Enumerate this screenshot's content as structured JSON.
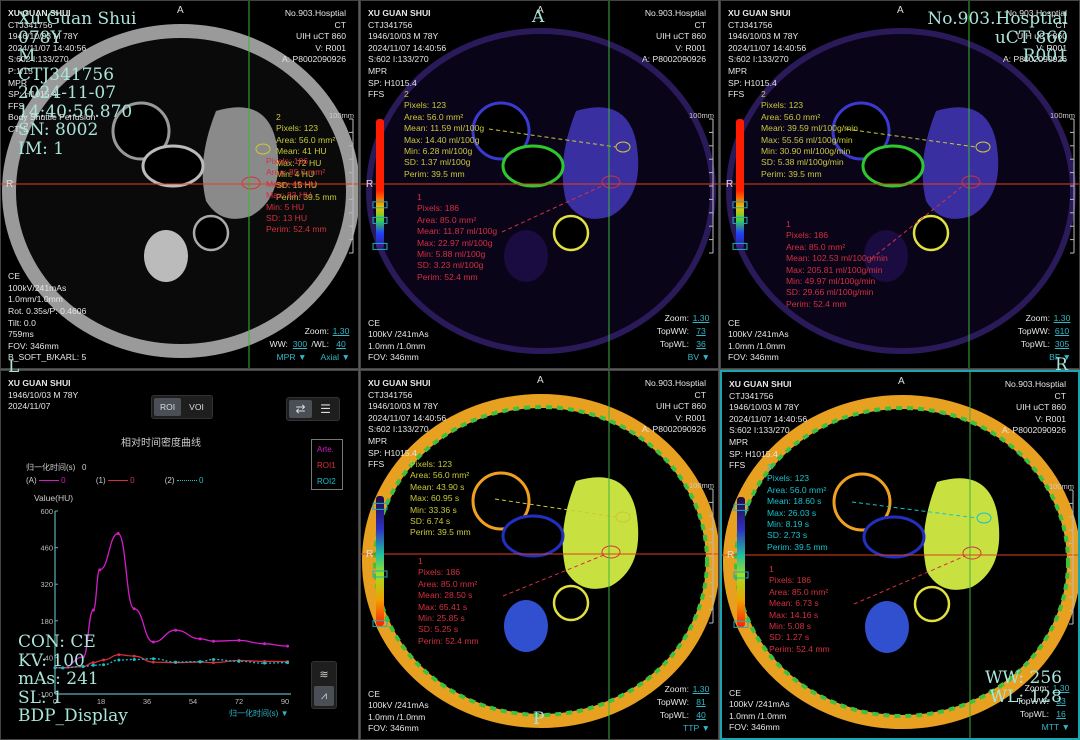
{
  "colors": {
    "roi1": "#d43040",
    "roi2": "#c9c93a",
    "roi2_mtt": "#14c4d0",
    "crosshair_v": "#3bb53b",
    "crosshair_h": "#e0401a",
    "accent": "#2fb7c8"
  },
  "panels": [
    {
      "id": "p0",
      "colormap": "gray",
      "top_left": [
        "XU GUAN SHUI",
        "CTJ341756",
        "1946/10/03 M 78Y",
        "2024/11/07 14:40:56",
        "S:602 I:133/270",
        "P:1/15",
        "MPR",
        "SP: H1015.4",
        "FFS",
        "Body Shuttle Perfusion",
        "CT: 5"
      ],
      "top_right": [
        "No.903.Hosptial",
        "CT",
        "UIH  uCT 860",
        "V: R001",
        "A: P8002090926"
      ],
      "bottom_left": [
        "CE",
        "100kV/241mAs",
        "1.0mm/1.0mm",
        "Rot. 0.35s/P: 0.4606",
        "Tilt: 0.0",
        "759ms",
        "FOV: 346mm",
        "B_SOFT_B/KARL: 5"
      ],
      "controls": [
        {
          "label": "Zoom:",
          "value": "1.30"
        },
        {
          "label": "WW:",
          "value": "300",
          "label2": "/WL:",
          "value2": "40"
        }
      ],
      "dropdowns": [
        "MPR",
        "Axial"
      ],
      "roi2": [
        "2",
        "Pixels: 123",
        "Area: 56.0 mm²",
        "Mean: 41 HU",
        "Max: 72 HU",
        "Min: 4 HU",
        "SD: 15 HU",
        "Perim: 39.5 mm"
      ],
      "roi1": [
        "Pixels: 186",
        "Area: 85.0 mm²",
        "Mean: 49 HU",
        "Max: 83 HU",
        "Min: 5 HU",
        "SD: 13 HU",
        "Perim: 52.4 mm"
      ],
      "orient_top": "A",
      "orient_left": "R",
      "scale": "100mm"
    },
    {
      "id": "p1",
      "colormap": "perf",
      "top_left": [
        "XU GUAN SHUI",
        "CTJ341756",
        "1946/10/03 M  78Y",
        "2024/11/07 14:40:56",
        "S:602  I:133/270",
        "MPR",
        "SP: H1015.4",
        "FFS"
      ],
      "top_right": [
        "No.903.Hosptial",
        "CT",
        "UIH  uCT 860",
        "V: R001",
        "A: P8002090926"
      ],
      "bottom_left": [
        "CE",
        "100kV /241mAs",
        "1.0mm /1.0mm",
        "FOV: 346mm"
      ],
      "controls": [
        {
          "label": "Zoom:",
          "value": "1.30"
        },
        {
          "label": "TopWW:",
          "value": "73"
        },
        {
          "label": "TopWL:",
          "value": "36"
        }
      ],
      "dropdowns": [
        "BV"
      ],
      "roi2": [
        "2",
        "Pixels: 123",
        "Area: 56.0 mm²",
        "Mean: 11.59 ml/100g",
        "Max: 14.40 ml/100g",
        "Min: 6.28 ml/100g",
        "SD: 1.37 ml/100g",
        "Perim: 39.5 mm"
      ],
      "roi1": [
        "1",
        "Pixels: 186",
        "Area: 85.0 mm²",
        "Mean: 11.87 ml/100g",
        "Max: 22.97 ml/100g",
        "Min: 5.88 ml/100g",
        "SD: 3.23 ml/100g",
        "Perim: 52.4 mm"
      ],
      "orient_top": "A",
      "orient_left": "R",
      "scale": "100mm"
    },
    {
      "id": "p2",
      "colormap": "perf",
      "top_left": [
        "XU GUAN SHUI",
        "CTJ341756",
        "1946/10/03 M  78Y",
        "2024/11/07 14:40:56",
        "S:602  I:133/270",
        "MPR",
        "SP: H1015.4",
        "FFS"
      ],
      "top_right": [
        "No.903.Hosptial",
        "CT",
        "UIH  uCT 860",
        "V: R001",
        "A: P8002090926"
      ],
      "bottom_left": [
        "CE",
        "100kV /241mAs",
        "1.0mm /1.0mm",
        "FOV: 346mm"
      ],
      "controls": [
        {
          "label": "Zoom:",
          "value": "1.30"
        },
        {
          "label": "TopWW:",
          "value": "610"
        },
        {
          "label": "TopWL:",
          "value": "305"
        }
      ],
      "dropdowns": [
        "BF"
      ],
      "roi2": [
        "2",
        "Pixels: 123",
        "Area: 56.0 mm²",
        "Mean: 39.59 ml/100g/min",
        "Max: 55.56 ml/100g/min",
        "Min: 30.90 ml/100g/min",
        "SD: 5.38 ml/100g/min",
        "Perim: 39.5 mm"
      ],
      "roi1": [
        "1",
        "Pixels: 186",
        "Area: 85.0 mm²",
        "Mean: 102.53 ml/100g/min",
        "Max: 205.81 ml/100g/min",
        "Min: 49.97 ml/100g/min",
        "SD: 29.66 ml/100g/min",
        "Perim: 52.4 mm"
      ],
      "orient_top": "A",
      "orient_left": "R",
      "scale": "100mm"
    },
    {
      "id": "p4",
      "colormap": "rainbow",
      "top_left": [
        "XU GUAN SHUI",
        "CTJ341756",
        "1946/10/03 M  78Y",
        "2024/11/07 14:40:56",
        "S:602  I:133/270",
        "MPR",
        "SP: H1015.4",
        "FFS"
      ],
      "top_right": [
        "No.903.Hosptial",
        "CT",
        "UIH  uCT 860",
        "V: R001",
        "A: P8002090926"
      ],
      "bottom_left": [
        "CE",
        "100kV /241mAs",
        "1.0mm /1.0mm",
        "FOV: 346mm"
      ],
      "controls": [
        {
          "label": "Zoom:",
          "value": "1.30"
        },
        {
          "label": "TopWW:",
          "value": "81"
        },
        {
          "label": "TopWL:",
          "value": "40"
        }
      ],
      "dropdowns": [
        "TTP"
      ],
      "roi2": [
        "Pixels: 123",
        "Area: 56.0 mm²",
        "Mean: 43.90 s",
        "Max: 60.95 s",
        "Min: 33.36 s",
        "SD: 6.74 s",
        "Perim: 39.5 mm"
      ],
      "roi1": [
        "1",
        "Pixels: 186",
        "Area: 85.0 mm²",
        "Mean: 28.50 s",
        "Max: 65.41 s",
        "Min: 25.85 s",
        "SD: 5.25 s",
        "Perim: 52.4 mm"
      ],
      "orient_top": "A",
      "orient_left": "R",
      "scale": "100mm"
    },
    {
      "id": "p5",
      "colormap": "rainbow",
      "top_left": [
        "XU GUAN SHUI",
        "CTJ341756",
        "1946/10/03 M  78Y",
        "2024/11/07 14:40:56",
        "S:602  I:133/270",
        "MPR",
        "SP: H1015.4",
        "FFS"
      ],
      "top_right": [
        "No.903.Hosptial",
        "CT",
        "UIH  uCT 860",
        "V: R001",
        "A: P8002090926"
      ],
      "bottom_left": [
        "CE",
        "100kV /241mAs",
        "1.0mm /1.0mm",
        "FOV: 346mm"
      ],
      "controls": [
        {
          "label": "Zoom:",
          "value": "1.30"
        },
        {
          "label": "TopWW:",
          "value": "33"
        },
        {
          "label": "TopWL:",
          "value": "16"
        }
      ],
      "dropdowns": [
        "MTT"
      ],
      "roi2": [
        "2",
        "Pixels: 123",
        "Area: 56.0 mm²",
        "Mean: 18.60 s",
        "Max: 26.03 s",
        "Min: 8.19 s",
        "SD: 2.73 s",
        "Perim: 39.5 mm"
      ],
      "roi1": [
        "1",
        "Pixels: 186",
        "Area: 85.0 mm²",
        "Mean: 6.73 s",
        "Max: 14.16 s",
        "Min: 5.08 s",
        "SD: 1.27 s",
        "Perim: 52.4 mm"
      ],
      "orient_top": "A",
      "orient_left": "R",
      "scale": "100mm"
    }
  ],
  "curve_panel": {
    "patient": [
      "XU GUAN SHUI",
      "1946/10/03 M 78Y",
      "2024/11/07"
    ],
    "mode_tabs": [
      {
        "label": "ROI",
        "active": true
      },
      {
        "label": "VOI",
        "active": false
      }
    ],
    "norm_time_label": "归一化时间(s)",
    "norm_time_value": "0",
    "series_readout": [
      {
        "key": "(A)",
        "value": "0"
      },
      {
        "key": "(1)",
        "value": "0"
      },
      {
        "key": "(2)",
        "value": "0"
      }
    ]
  },
  "chart_data": {
    "type": "line",
    "title": "相对时间密度曲线",
    "xlabel": "归一化时间(s)",
    "ylabel": "Value(HU)",
    "xlim": [
      0,
      92
    ],
    "ylim": [
      -100,
      600
    ],
    "xticks": [
      "0",
      "18",
      "36",
      "54",
      "72",
      "90"
    ],
    "yticks": [
      "600",
      "460",
      "320",
      "180",
      "40",
      "-100"
    ],
    "legend": [
      "Arte.",
      "ROI1",
      "ROI2"
    ],
    "legend_position": "top-right",
    "series": [
      {
        "name": "Arte.",
        "color": "#d21ec8",
        "dashed": false,
        "x": [
          0,
          3,
          11,
          15,
          17.5,
          24.7,
          31,
          38.5,
          47.2,
          56.8,
          62,
          72,
          82,
          91
        ],
        "y": [
          2,
          0,
          41,
          221,
          375,
          514,
          226,
          99,
          144,
          111,
          102,
          105,
          92,
          83
        ]
      },
      {
        "name": "ROI1",
        "color": "#d43040",
        "dashed": false,
        "x": [
          0,
          3,
          11,
          15,
          19,
          25,
          31,
          38.5,
          47.2,
          56.8,
          62,
          72,
          82,
          91
        ],
        "y": [
          2,
          0,
          5,
          20,
          30,
          50,
          45,
          22,
          20,
          22,
          20,
          28,
          25,
          24
        ]
      },
      {
        "name": "ROI2",
        "color": "#18c0c8",
        "dashed": true,
        "x": [
          0,
          3,
          11,
          15,
          19,
          25,
          31,
          38.5,
          47.2,
          56.8,
          62,
          72,
          82,
          91
        ],
        "y": [
          0,
          0,
          5,
          10,
          12,
          30,
          32,
          35,
          22,
          24,
          32,
          25,
          18,
          20
        ]
      }
    ]
  },
  "overlays": {
    "left_top": [
      "Xu Guan Shui",
      "078Y",
      "M",
      "CTJ341756",
      "2024-11-07",
      "14:40:56.870",
      "SN: 8002",
      "IM: 1"
    ],
    "left_bottom": [
      "CON: CE",
      "KV: 100",
      "mAs: 241",
      "SL: 1",
      "BDP_Display"
    ],
    "right_top": [
      "No.903.Hosptial",
      "uCT 860",
      "R001"
    ],
    "right_bottom": [
      "WW: 256",
      "WL: 128"
    ],
    "orient_L": "L",
    "orient_R": "R",
    "orient_P": "P",
    "orient_A": "A"
  }
}
